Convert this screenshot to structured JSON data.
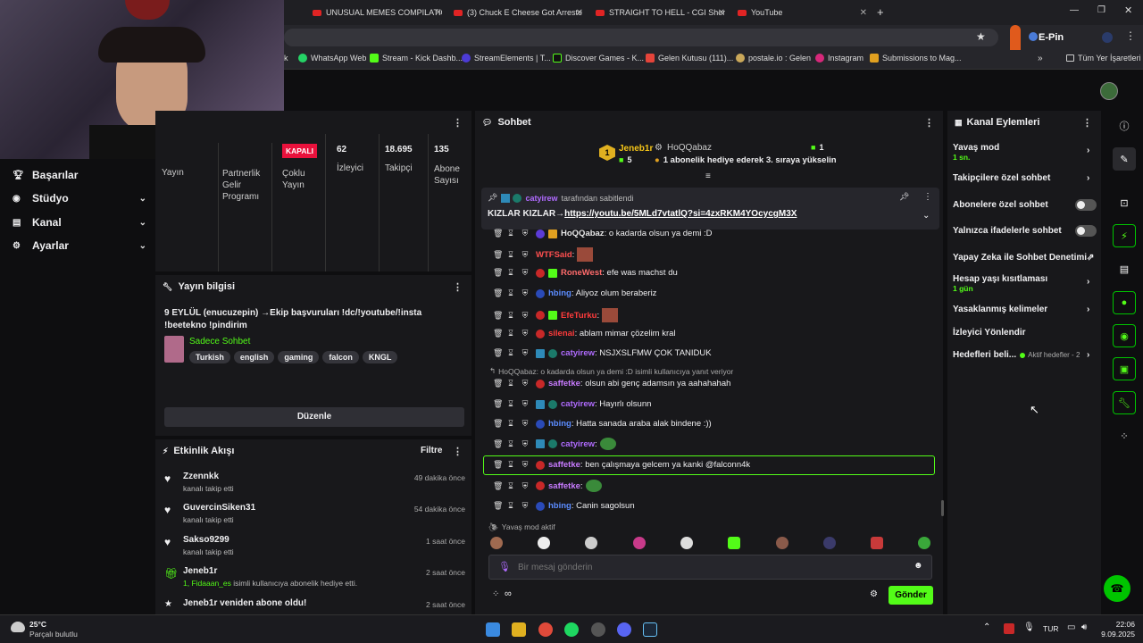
{
  "tabs": [
    {
      "label": "UNUSUAL MEMES COMPILATIO"
    },
    {
      "label": "(3) Chuck E Cheese Got Arreste"
    },
    {
      "label": "STRAIGHT TO HELL - CGI Short"
    },
    {
      "label": "YouTube"
    }
  ],
  "address_bar": {
    "extension_label": "E-Pin"
  },
  "bookmarks": [
    "WhatsApp Web",
    "Stream - Kick Dashb...",
    "StreamElements | T...",
    "Discover Games - K...",
    "Gelen Kutusu (111)...",
    "postale.io : Gelen",
    "Instagram",
    "Submissions to Mag...",
    "Tüm Yer İşaretleri"
  ],
  "sidebar": {
    "items": [
      {
        "label": "Başarılar",
        "icon": "trophy-icon"
      },
      {
        "label": "Stüdyo",
        "icon": "studio-icon"
      },
      {
        "label": "Kanal",
        "icon": "channel-icon"
      },
      {
        "label": "Ayarlar",
        "icon": "gear-icon"
      }
    ]
  },
  "stats": {
    "yayin_label": "Yayın",
    "partner_label": "Partnerlik Gelir Programı",
    "status_badge": "KAPALI",
    "multi_label": "Çoklu Yayın",
    "viewers_value": "62",
    "viewers_label": "İzleyici",
    "followers_value": "18.695",
    "followers_label": "Takipçi",
    "subs_value": "135",
    "subs_label": "Abone Sayısı"
  },
  "stream_info": {
    "header": "Yayın bilgisi",
    "title": "9 EYLÜL (enucuzepin) →Ekip başvuruları !dc/!youtube/!insta !beetekno !pindirim",
    "category": "Sadece Sohbet",
    "tags": [
      "Turkish",
      "english",
      "gaming",
      "falcon",
      "KNGL"
    ],
    "edit_button": "Düzenle"
  },
  "activity": {
    "header": "Etkinlik Akışı",
    "filter_label": "Filtre",
    "items": [
      {
        "name": "Zzennkk",
        "sub": "kanalı takip etti",
        "time": "49 dakika önce",
        "icon": "heart-icon"
      },
      {
        "name": "GuvercinSiken31",
        "sub": "kanalı takip etti",
        "time": "54 dakika önce",
        "icon": "heart-icon"
      },
      {
        "name": "Sakso9299",
        "sub": "kanalı takip etti",
        "time": "1 saat önce",
        "icon": "heart-icon"
      },
      {
        "name": "Jeneb1r",
        "sub_user": "1, Fidaaan_es",
        "sub": " isimli kullanıcıya abonelik hediye etti.",
        "time": "2 saat önce",
        "icon": "gift-icon"
      },
      {
        "name": "Jeneb1r veniden abone oldu!",
        "sub": "",
        "time": "2 saat önce",
        "icon": "star-icon"
      }
    ]
  },
  "chat": {
    "header": "Sohbet",
    "gifter_name": "Jeneb1r",
    "gifter_count": "5",
    "gifter_rank": "1",
    "highlight_user": "HoQQabaz",
    "highlight_count": "1",
    "highlight_text": "1 abonelik hediye ederek 3. sıraya yükselin",
    "pinned_by": "catyirew",
    "pinned_suffix": "tarafından sabitlendi",
    "pinned_prefix": "KIZLAR KIZLAR→",
    "pinned_link": "https://youtu.be/5MLd7vtatlQ?si=4zxRKM4YOcycgM3X",
    "messages": [
      {
        "user": "HoQQabaz",
        "color": "#e6e6e6",
        "text": ": o kadarda olsun ya demi :D"
      },
      {
        "user": "WTFSaid",
        "color": "#ff4f4f",
        "text": ":"
      },
      {
        "user": "RoneWest",
        "color": "#ff6b6b",
        "text": ": efe was machst du"
      },
      {
        "user": "hbing",
        "color": "#5b8cff",
        "text": ": Aliyoz olum beraberiz"
      },
      {
        "user": "EfeTurku",
        "color": "#ff3b3b",
        "text": ":"
      },
      {
        "user": "silenai",
        "color": "#ff3b3b",
        "text": ": ablam mimar çözelim kral"
      },
      {
        "user": "catyirew",
        "color": "#b06bff",
        "text": ": NSJXSLFMW ÇOK TANIDUK"
      },
      {
        "reply": "HoQQabaz: o kadarda olsun ya demi :D isimli kullanıcıya yanıt veriyor"
      },
      {
        "user": "saffetke",
        "color": "#c87bff",
        "text": ": olsun abi genç adamsın ya aahahahah"
      },
      {
        "user": "catyirew",
        "color": "#b06bff",
        "text": ": Hayırlı olsunn"
      },
      {
        "user": "hbing",
        "color": "#5b8cff",
        "text": ": Hatta sanada araba alak bindene :))"
      },
      {
        "user": "catyirew",
        "color": "#b06bff",
        "text": ":"
      },
      {
        "user": "saffetke",
        "color": "#c87bff",
        "text": ": ben çalışmaya gelcem ya kanki @falconn4k"
      },
      {
        "user": "saffetke",
        "color": "#c87bff",
        "text": ":"
      },
      {
        "user": "hbing",
        "color": "#5b8cff",
        "text": ": Canin sagolsun"
      }
    ],
    "slow_mode": "Yavaş mod aktif",
    "input_placeholder": "Bir mesaj gönderin",
    "send_button": "Gönder"
  },
  "channel_actions": {
    "header": "Kanal Eylemleri",
    "items": [
      {
        "label": "Yavaş mod",
        "sub": "1 sn."
      },
      {
        "label": "Takipçilere özel sohbet"
      },
      {
        "label": "Abonelere özel sohbet"
      },
      {
        "label": "Yalnızca ifadelerle sohbet"
      },
      {
        "label": "Yapay Zeka ile Sohbet Denetimi"
      },
      {
        "label": "Hesap yaşı kısıtlaması",
        "sub": "1 gün"
      },
      {
        "label": "Yasaklanmış kelimeler"
      },
      {
        "label": "İzleyici Yönlendir"
      },
      {
        "label": "Hedefleri beli...",
        "sub": "Aktif hedefler - 2"
      }
    ]
  },
  "taskbar": {
    "temp": "25°C",
    "weather": "Parçalı bulutlu",
    "lang": "TUR",
    "time": "22:06",
    "date": "9.09.2025"
  },
  "colors": {
    "accent": "#53fc18",
    "bg": "#0e0e10",
    "panel": "#18181b",
    "live_red": "#e9113c"
  }
}
